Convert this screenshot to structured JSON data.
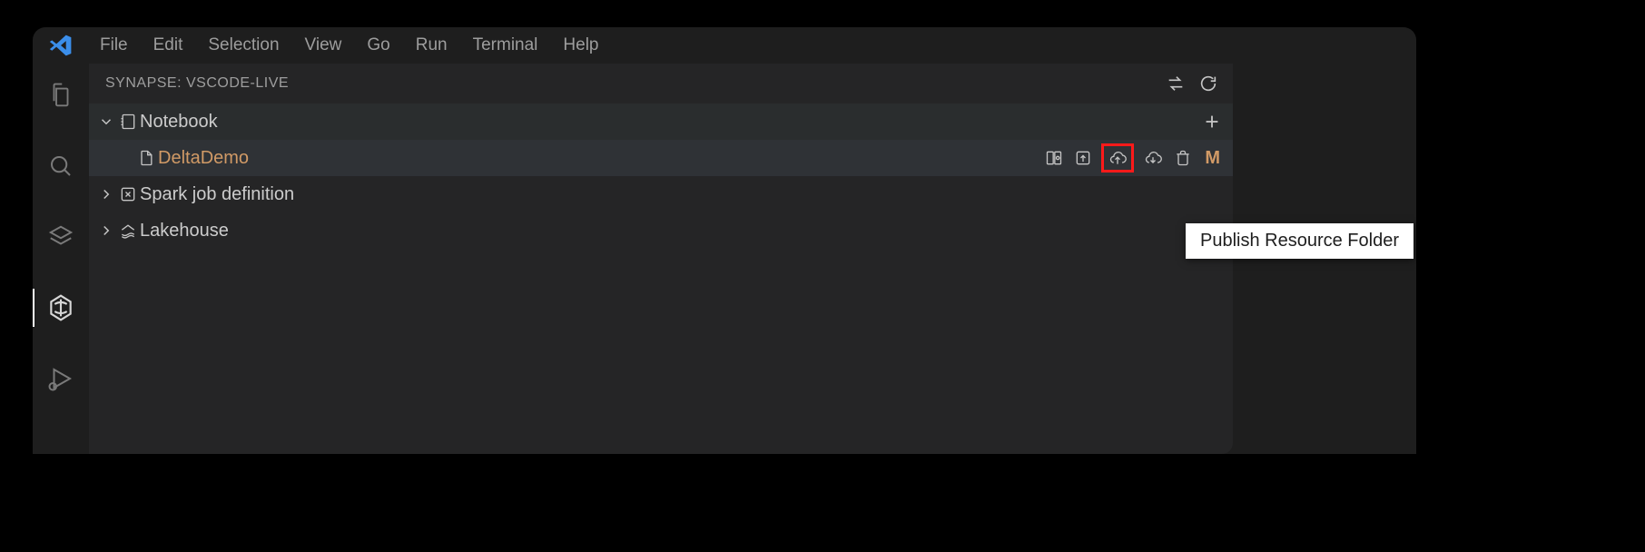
{
  "menu": {
    "items": [
      "File",
      "Edit",
      "Selection",
      "View",
      "Go",
      "Run",
      "Terminal",
      "Help"
    ]
  },
  "activitybar": {
    "items": [
      {
        "name": "explorer",
        "active": false
      },
      {
        "name": "search",
        "active": false
      },
      {
        "name": "layers",
        "active": false
      },
      {
        "name": "synapse",
        "active": true
      },
      {
        "name": "run-debug",
        "active": false
      }
    ]
  },
  "sidebar": {
    "title": "SYNAPSE: VSCODE-LIVE",
    "header_actions": {
      "sync": "sync",
      "refresh": "refresh"
    },
    "tree": {
      "notebook": {
        "label": "Notebook",
        "expanded": true,
        "add_action": "add",
        "items": [
          {
            "label": "DeltaDemo",
            "modified_badge": "M",
            "actions": [
              "open-preview",
              "upload",
              "publish-resource-folder",
              "download",
              "delete"
            ]
          }
        ]
      },
      "spark": {
        "label": "Spark job definition",
        "expanded": false
      },
      "lakehouse": {
        "label": "Lakehouse",
        "expanded": false
      }
    }
  },
  "tooltip": {
    "text": "Publish Resource Folder"
  }
}
